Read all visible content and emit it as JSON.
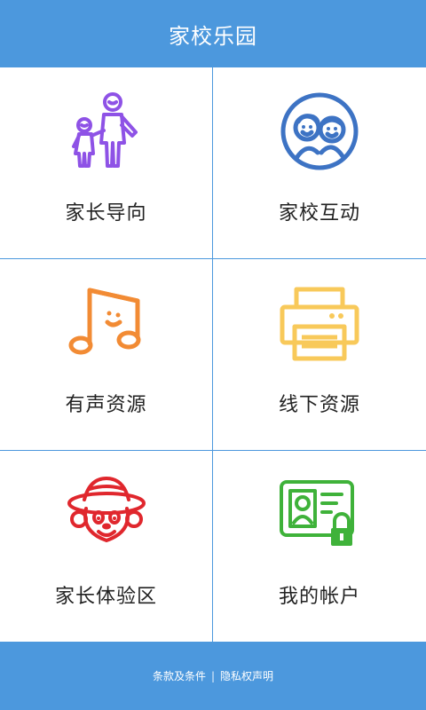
{
  "header": {
    "title": "家校乐园"
  },
  "menu": {
    "items": [
      {
        "label": "家长导向",
        "icon": "parent-child-icon",
        "color": "#8e52e6"
      },
      {
        "label": "家校互动",
        "icon": "two-faces-icon",
        "color": "#3d73c4"
      },
      {
        "label": "有声资源",
        "icon": "music-note-icon",
        "color": "#f28b34"
      },
      {
        "label": "线下资源",
        "icon": "printer-icon",
        "color": "#f8c95a"
      },
      {
        "label": "家长体验区",
        "icon": "mouse-mascot-icon",
        "color": "#e0272d"
      },
      {
        "label": "我的帐户",
        "icon": "account-card-lock-icon",
        "color": "#3fb23a"
      }
    ]
  },
  "footer": {
    "terms": "条款及条件",
    "separator": "|",
    "privacy": "隐私权声明"
  },
  "colors": {
    "brand": "#4c98dd"
  }
}
